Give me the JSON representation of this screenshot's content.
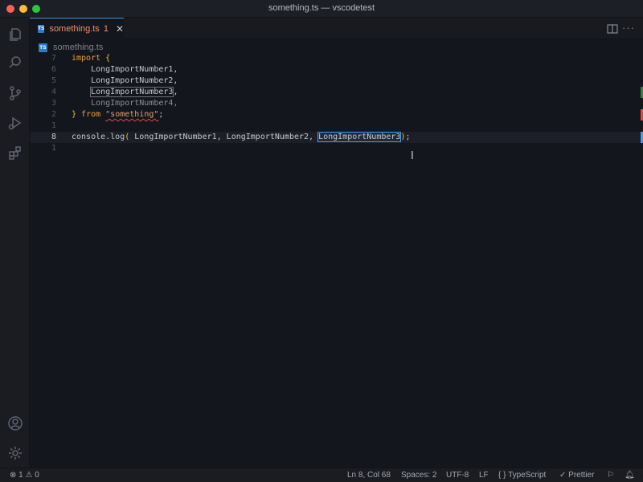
{
  "window": {
    "title": "something.ts — vscodetest"
  },
  "tab": {
    "badge": "TS",
    "label": "something.ts",
    "problem_count": "1",
    "close": "✕"
  },
  "breadcrumb": {
    "badge": "TS",
    "file": "something.ts"
  },
  "editor": {
    "lines": [
      {
        "number": "7",
        "tokens": [
          "import",
          " {"
        ]
      },
      {
        "number": "6",
        "text": "    LongImportNumber1,"
      },
      {
        "number": "5",
        "text": "    LongImportNumber2,"
      },
      {
        "number": "4",
        "text_boxed": "LongImportNumber3",
        "suffix": ","
      },
      {
        "number": "3",
        "text": "    LongImportNumber4,"
      },
      {
        "number": "2",
        "tokens": [
          "}",
          " from ",
          "\"something\"",
          ";"
        ]
      },
      {
        "number": "1",
        "text": ""
      },
      {
        "number": "8",
        "prefix": "console.log",
        "paren_open": "(",
        "args": " LongImportNumber1, LongImportNumber2, ",
        "selected": "LongImportNumber3",
        "paren_close": ")",
        "end": ";"
      },
      {
        "number": "1",
        "text": ""
      }
    ]
  },
  "statusbar": {
    "errors": "1",
    "warnings": "0",
    "position": "Ln 8, Col 68",
    "spaces": "Spaces: 2",
    "encoding": "UTF-8",
    "eol": "LF",
    "language": "TypeScript",
    "language_icon": "{ }",
    "formatter": "Prettier"
  },
  "colors": {
    "accent": "#4c9ae6",
    "keyword": "#e8a33d",
    "error": "#e04848",
    "tab_modified": "#f08d6d"
  }
}
